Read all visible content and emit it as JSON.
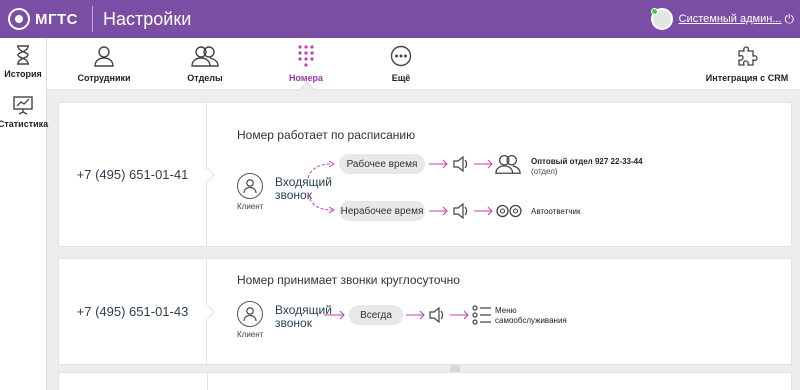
{
  "header": {
    "logo": "МГТС",
    "title": "Настройки",
    "user_name": "Системный админ...",
    "power_glyph": "⏻",
    "brand_color": "#7b4ea6"
  },
  "sidebar": {
    "items": [
      {
        "label": "История",
        "icon": "hourglass-icon"
      },
      {
        "label": "Статистика",
        "icon": "presentation-chart-icon"
      }
    ]
  },
  "tabs": {
    "items": [
      {
        "label": "Сотрудники",
        "icon": "user-icon",
        "active": false
      },
      {
        "label": "Отделы",
        "icon": "users-icon",
        "active": false
      },
      {
        "label": "Номера",
        "icon": "dialpad-icon",
        "active": true
      },
      {
        "label": "Ещё",
        "icon": "more-icon",
        "active": false
      },
      {
        "label": "Интеграция с CRM",
        "icon": "puzzle-icon",
        "active": false
      }
    ],
    "active_color": "#9c3aa8"
  },
  "numbers": [
    {
      "phone": "+7 (495) 651-01-41",
      "title": "Номер работает по расписанию",
      "client_label": "Клиент",
      "incoming_label_line1": "Входящий",
      "incoming_label_line2": "звонок",
      "branches": [
        {
          "pill": "Рабочее время",
          "dest_title": "Оптовый отдел 927 22-33-44",
          "dest_sub": "(отдел)",
          "dest_icon": "users-icon"
        },
        {
          "pill": "Нерабочее время",
          "dest_title": "Автоответчик",
          "dest_icon": "voicemail-icon"
        }
      ]
    },
    {
      "phone": "+7 (495) 651-01-43",
      "title": "Номер принимает звонки круглосуточно",
      "client_label": "Клиент",
      "incoming_label_line1": "Входящий",
      "incoming_label_line2": "звонок",
      "branches": [
        {
          "pill": "Всегда",
          "dest_line1": "Меню",
          "dest_line2": "самообслуживания",
          "dest_icon": "list-icon"
        }
      ]
    }
  ],
  "accent_color": "#c13fb6"
}
